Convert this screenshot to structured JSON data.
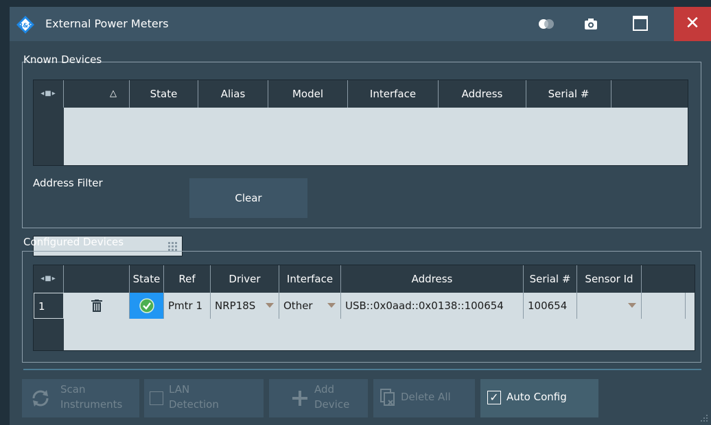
{
  "window": {
    "title": "External Power Meters",
    "close_label": "✕",
    "colors": {
      "titlebar": "#3d5566",
      "close": "#c43a3a",
      "body": "#344855",
      "table_bg": "#d3dde2",
      "header": "#2c3b45",
      "state_ok": "#2196f3"
    }
  },
  "known_devices": {
    "label": "Known Devices",
    "columns": [
      "△",
      "State",
      "Alias",
      "Model",
      "Interface",
      "Address",
      "Serial #"
    ],
    "rows": [],
    "address_filter_label": "Address Filter",
    "address_filter_value": "",
    "clear_label": "Clear"
  },
  "configured_devices": {
    "label": "Configured Devices",
    "columns": [
      "",
      "State",
      "Ref",
      "Driver",
      "Interface",
      "Address",
      "Serial #",
      "Sensor Id"
    ],
    "rows": [
      {
        "index": "1",
        "state_icon": "check-circle-icon",
        "ref": "Pmtr 1",
        "driver": "NRP18S",
        "interface": "Other",
        "address": "USB::0x0aad::0x0138::100654",
        "serial": "100654",
        "sensor_id": ""
      }
    ]
  },
  "toolbar": {
    "scan_line1": "Scan",
    "scan_line2": "Instruments",
    "lan_line1": "LAN",
    "lan_line2": "Detection",
    "add_line1": "Add",
    "add_line2": "Device",
    "delete_all": "Delete All",
    "auto_config": "Auto Config",
    "auto_config_checked": true,
    "lan_checked": false
  }
}
